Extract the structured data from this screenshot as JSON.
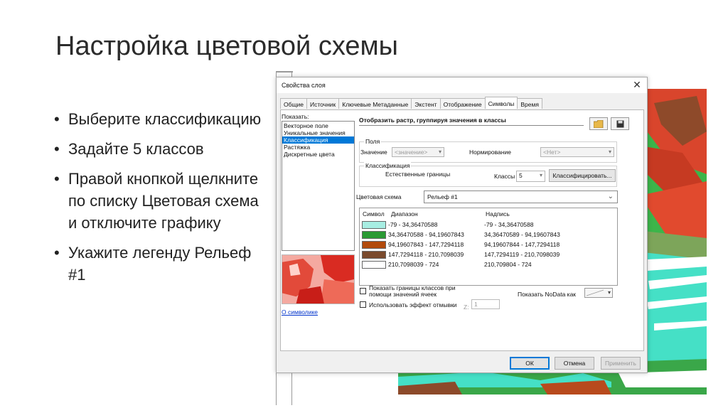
{
  "slide": {
    "title": "Настройка цветовой схемы",
    "bullets": [
      "Выберите классификацию",
      "Задайте 5 классов",
      "Правой кнопкой щелкните по списку Цветовая схема и отключите графику",
      "Укажите легенду Рельеф #1"
    ]
  },
  "dialog": {
    "title": "Свойства слоя",
    "close_icon": "close-icon",
    "tabs": [
      "Общие",
      "Источник",
      "Ключевые Метаданные",
      "Экстент",
      "Отображение",
      "Символы",
      "Время"
    ],
    "active_tab": "Символы",
    "show_label": "Показать:",
    "show_items": [
      "Векторное поле",
      "Уникальные значения",
      "Классификация",
      "Растяжка",
      "Дискретные цвета"
    ],
    "selected_show_item": "Классификация",
    "about_symbols_link": "О символике",
    "heading": "Отобразить растр, группируя значения в классы",
    "fields_group_label": "Поля",
    "value_label": "Значение",
    "value_combo": "<значение>",
    "normalization_label": "Нормирование",
    "normalization_combo": "<Нет>",
    "classification_group_label": "Классификация",
    "method": "Естественные границы",
    "classes_label": "Классы",
    "classes_value": "5",
    "classify_button": "Классифицировать...",
    "color_ramp_label": "Цветовая схема",
    "color_ramp_value": "Рельеф #1",
    "table_headers": {
      "symbol": "Символ",
      "range": "Диапазон",
      "label": "Надпись"
    },
    "classes": [
      {
        "color": "#a7ede2",
        "range": "-79 - 34,36470588",
        "label": "-79 - 34,36470588"
      },
      {
        "color": "#2b9a34",
        "range": "34,36470588 - 94,19607843",
        "label": "34,36470589 - 94,19607843"
      },
      {
        "color": "#b24a0c",
        "range": "94,19607843 - 147,7294118",
        "label": "94,19607844 - 147,7294118"
      },
      {
        "color": "#7a4a2d",
        "range": "147,7294118 - 210,7098039",
        "label": "147,7294119 - 210,7098039"
      },
      {
        "color": "#ffffff",
        "range": "210,7098039 - 724",
        "label": "210,709804 - 724"
      }
    ],
    "show_class_breaks_label": "Показать границы классов при помощи значений ячеек",
    "hillshade_label": "Использовать эффект отмывки",
    "z_label": "Z:",
    "z_value": "1",
    "nodata_label": "Показать NoData как",
    "ok_button": "ОК",
    "cancel_button": "Отмена",
    "apply_button": "Применить"
  },
  "colors": {
    "accent": "#0078d7",
    "map_green": "#2e9a3a",
    "map_cyan": "#42e0c8",
    "map_red": "#d0402a",
    "map_brown": "#8a4a2a"
  }
}
